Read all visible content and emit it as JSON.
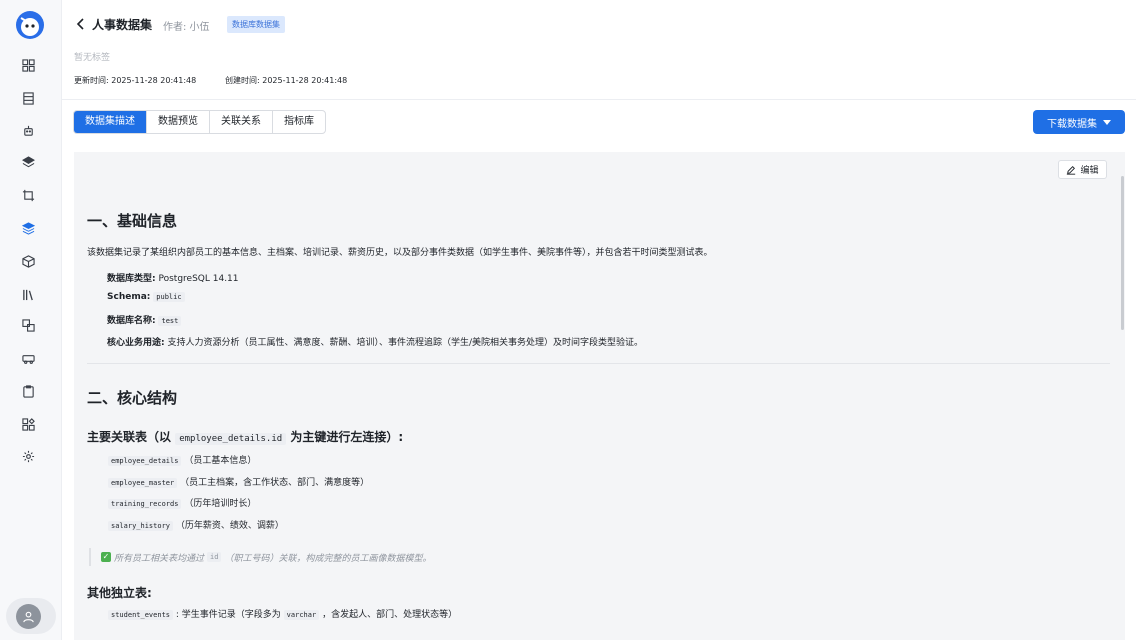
{
  "header": {
    "title": "人事数据集",
    "author": "作者: 小伍",
    "badge": "数据库数据集",
    "no_tags": "暂无标签",
    "updated": "更新时间: 2025-11-28 20:41:48",
    "created": "创建时间: 2025-11-28 20:41:48"
  },
  "tabs": [
    {
      "label": "数据集描述",
      "active": true
    },
    {
      "label": "数据预览",
      "active": false
    },
    {
      "label": "关联关系",
      "active": false
    },
    {
      "label": "指标库",
      "active": false
    }
  ],
  "download_label": "下载数据集",
  "edit_label": "编辑",
  "doc": {
    "section1_title": "一、基础信息",
    "section1_desc": "该数据集记录了某组织内部员工的基本信息、主档案、培训记录、薪资历史，以及部分事件类数据（如学生事件、美院事件等），并包含若干时间类型测试表。",
    "db_type_label": "数据库类型:",
    "db_type_value": "PostgreSQL 14.11",
    "schema_label": "Schema:",
    "schema_value": "public",
    "db_name_label": "数据库名称:",
    "db_name_value": "test",
    "use_label": "核心业务用途:",
    "use_value": "支持人力资源分析（员工属性、满意度、薪酬、培训）、事件流程追踪（学生/美院相关事务处理）及时间字段类型验证。",
    "section2_title": "二、核心结构",
    "main_tables_prefix": "主要关联表（以",
    "main_tables_code": "employee_details.id",
    "main_tables_suffix": "为主键进行左连接）:",
    "main_tables": [
      {
        "code": "employee_details",
        "desc": "（员工基本信息）"
      },
      {
        "code": "employee_master",
        "desc": "（员工主档案，含工作状态、部门、满意度等）"
      },
      {
        "code": "training_records",
        "desc": "（历年培训时长）"
      },
      {
        "code": "salary_history",
        "desc": "（历年薪资、绩效、调薪）"
      }
    ],
    "quote_prefix": "所有员工相关表均通过",
    "quote_code": "id",
    "quote_suffix": "（职工号码）关联，构成完整的员工画像数据模型。",
    "other_title": "其他独立表:",
    "other_tables": [
      {
        "code": "student_events",
        "desc_prefix": ": 学生事件记录（字段多为",
        "desc_code": "varchar",
        "desc_suffix": "，含发起人、部门、处理状态等）"
      }
    ]
  }
}
